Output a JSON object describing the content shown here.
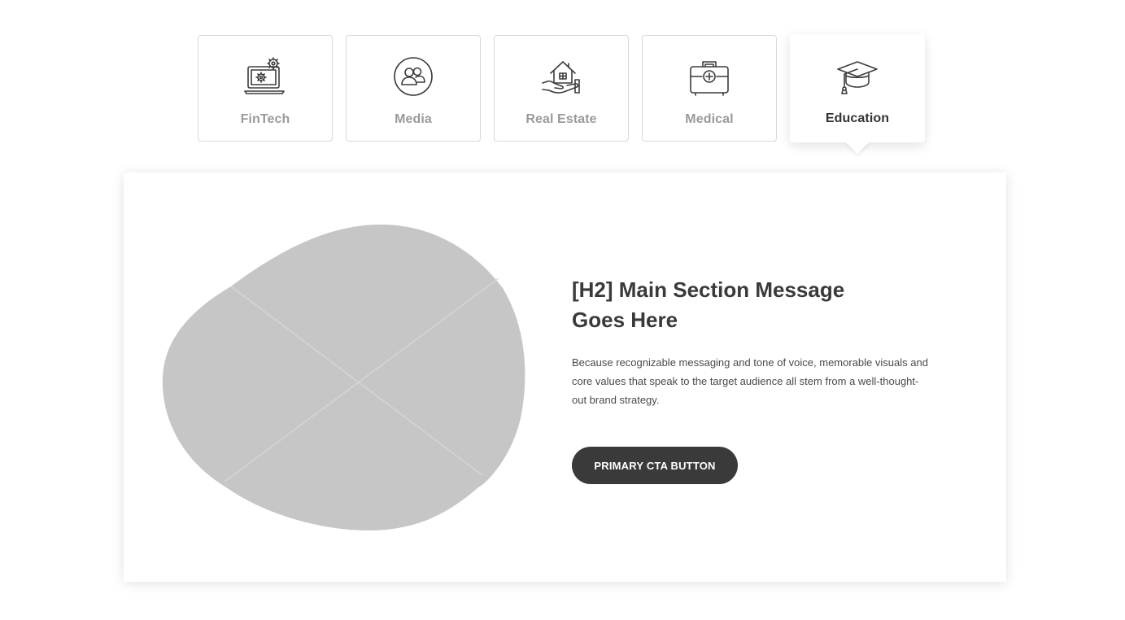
{
  "tabs": [
    {
      "label": "FinTech",
      "icon": "laptop-gear-icon",
      "active": false
    },
    {
      "label": "Media",
      "icon": "people-circle-icon",
      "active": false
    },
    {
      "label": "Real Estate",
      "icon": "house-hand-icon",
      "active": false
    },
    {
      "label": "Medical",
      "icon": "medical-kit-icon",
      "active": false
    },
    {
      "label": "Education",
      "icon": "graduation-cap-icon",
      "active": true
    }
  ],
  "section": {
    "heading": "[H2] Main Section Message Goes Here",
    "body": "Because recognizable messaging and tone of voice, memorable visuals and core values that speak to the target audience all stem from a well-thought-out brand strategy.",
    "cta_label": "PRIMARY CTA BUTTON",
    "image_placeholder": "image-placeholder-blob"
  },
  "colors": {
    "accent": "#3a3a3a",
    "placeholder": "#c6c6c6",
    "inactive_label": "#9a9a9a",
    "border": "#d8d8d8"
  }
}
